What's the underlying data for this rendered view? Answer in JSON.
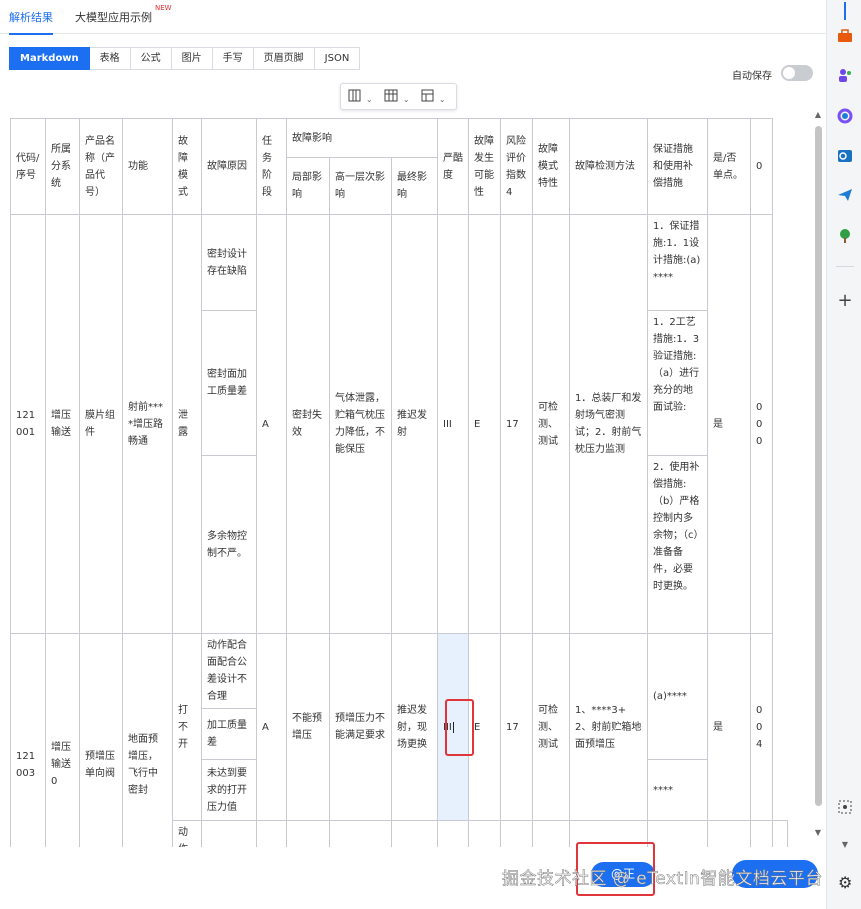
{
  "top_tabs": [
    {
      "label": "解析结果",
      "active": true
    },
    {
      "label": "大模型应用示例",
      "badge": "NEW",
      "active": false
    }
  ],
  "format_tabs": [
    "Markdown",
    "表格",
    "公式",
    "图片",
    "手写",
    "页眉页脚",
    "JSON"
  ],
  "format_tab_active": "Markdown",
  "autosave": {
    "label": "自动保存",
    "on": false
  },
  "table_toolbar": {
    "icons": [
      "insert-column-icon",
      "insert-row-icon",
      "merge-cells-icon"
    ]
  },
  "table": {
    "header": {
      "code": "代码/序号",
      "subsystem": "所属分系统",
      "product": "产品名称（产品代号）",
      "function": "功能",
      "failure_mode": "故障模式",
      "cause": "故障原因",
      "phase": "任务阶段",
      "effect_group": "故障影响",
      "effect_local": "局部影响",
      "effect_higher": "高一层次影响",
      "effect_final": "最终影响",
      "severity": "严酷度",
      "likelihood": "故障发生可能性",
      "risk_index": "风险评价指数4",
      "mode_feature": "故障模式特性",
      "detection": "故障检测方法",
      "measures": "保证措施和使用补偿措施",
      "single_point": "是/否单点。",
      "last": "0"
    },
    "row1": {
      "code": "121001",
      "subsystem": "增压输送",
      "product": "膜片组件",
      "function": "射前****增压路畅通",
      "failure_mode": "泄露",
      "causes": [
        "密封设计存在缺陷",
        "密封面加工质量差",
        "多余物控制不严。"
      ],
      "phase": "A",
      "effect_local": "密封失效",
      "effect_higher": "气体泄露，贮箱气枕压力降低，不能保压",
      "effect_final": "推迟发射",
      "severity": "III",
      "likelihood": "E",
      "risk_index": "17",
      "mode_feature": "可检测、测试",
      "detection": "1．总装厂和发射场气密测试；2．射前气枕压力监测",
      "measures": [
        "1．保证措施:1．1设计措施:(a)****",
        "1．2工艺措施:1．3验证措施:（a）进行充分的地面试验:",
        "2．使用补偿措施:（b）严格控制内多余物；（c）准备备件，必要时更换。"
      ],
      "single_point": "是",
      "last": "000"
    },
    "row2": {
      "code": "121003",
      "subsystem": "增压输送0",
      "product": "预增压单向阀",
      "function": "地面预增压，飞行中密封",
      "failure_mode": "打不开",
      "causes": [
        "动作配合面配合公差设计不合理",
        "加工质量差",
        "未达到要求的打开压力值",
        "动作配合"
      ],
      "phase": "A",
      "effect_local": "不能预增压",
      "effect_higher": "预增压力不能满足要求",
      "effect_final": "推迟发射，现场更换",
      "severity": "III",
      "likelihood": "E",
      "risk_index": "17",
      "mode_feature": "可检测、测试",
      "detection": "1、****3+ 2、射前贮箱地面预增压",
      "measures": [
        "(a)****",
        "****"
      ],
      "single_point": "是",
      "last": "004"
    }
  },
  "floating": {
    "button_label": "@正"
  },
  "watermark": "掘金技术社区 @ eTextIn智能文档云平台"
}
